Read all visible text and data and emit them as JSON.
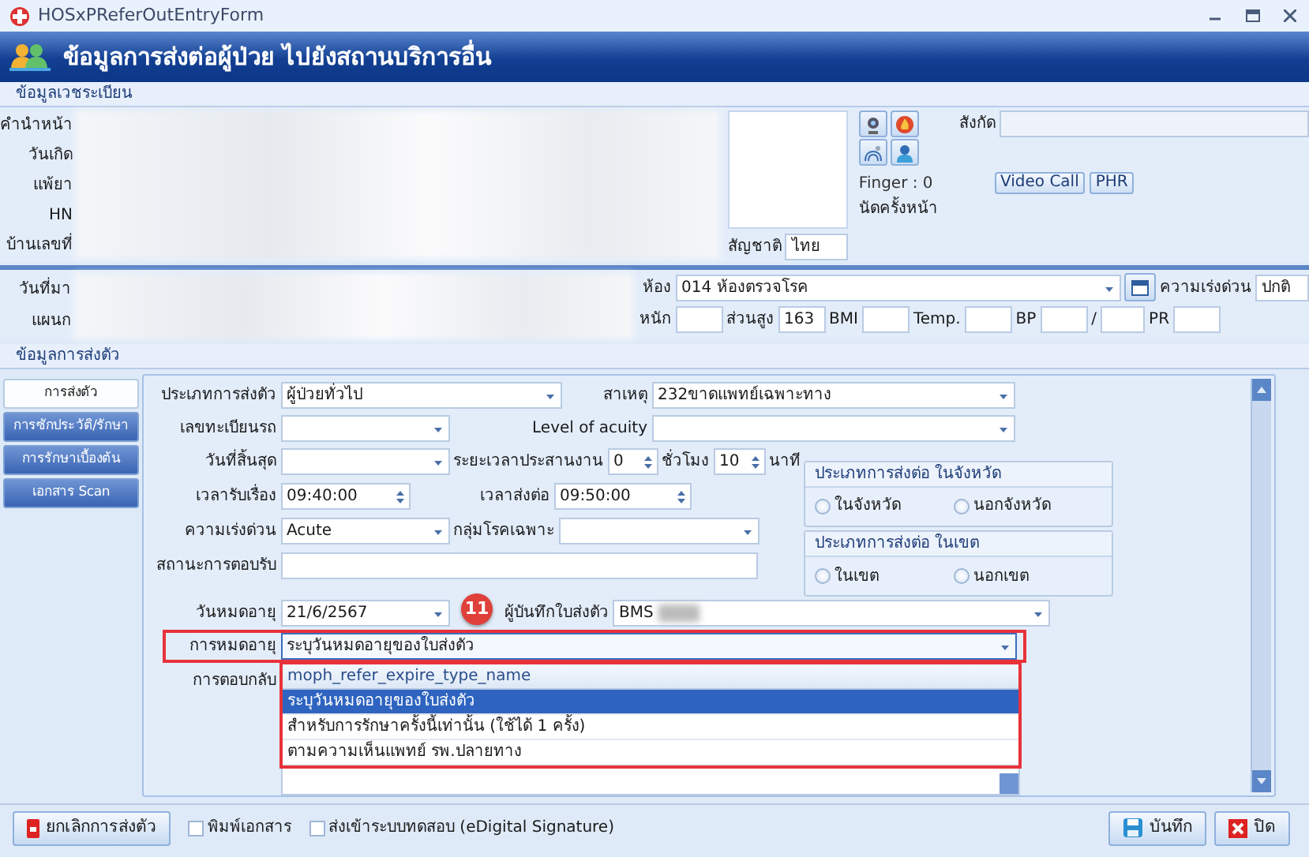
{
  "window": {
    "title": "HOSxPReferOutEntryForm"
  },
  "header": {
    "title": "ข้อมูลการส่งต่อผู้ป่วย ไปยังสถานบริการอื่น"
  },
  "registration": {
    "section_title": "ข้อมูลเวชระเบียน",
    "labels": [
      "คำนำหน้า",
      "วันเกิด",
      "แพ้ยา",
      "HN",
      "บ้านเลขที่"
    ],
    "nationality": {
      "label": "สัญชาติ",
      "value": "ไทย"
    },
    "finger": "Finger : 0",
    "next_appointment": "นัดครั้งหน้า",
    "affiliation": {
      "label": "สังกัด"
    },
    "buttons": [
      "Video Call",
      "PHR"
    ]
  },
  "visit": {
    "labels": [
      "วันที่มา",
      "แผนก"
    ],
    "room": {
      "label": "ห้อง",
      "value": "014 ห้องตรวจโรค"
    },
    "urgency": {
      "label": "ความเร่งด่วน",
      "value": "ปกติ"
    },
    "vitals": [
      {
        "label": "หนัก"
      },
      {
        "label": "ส่วนสูง",
        "value": "163"
      },
      {
        "label": "BMI"
      },
      {
        "label": "Temp."
      },
      {
        "label": "BP"
      },
      {
        "label": "/"
      },
      {
        "label": "PR"
      }
    ]
  },
  "referral": {
    "section_title": "ข้อมูลการส่งตัว",
    "tabs": [
      {
        "label": "การส่งตัว",
        "selected": true
      },
      {
        "label": "การซักประวัติ/รักษา",
        "selected": false
      },
      {
        "label": "การรักษาเบื้องต้น",
        "selected": false
      },
      {
        "label": "เอกสาร Scan",
        "selected": false
      }
    ],
    "refer_type": {
      "label": "ประเภทการส่งตัว",
      "value": "ผู้ป่วยทั่วไป"
    },
    "cause": {
      "label": "สาเหตุ",
      "value": "232ขาดแพทย์เฉพาะทาง"
    },
    "vehicle": {
      "label": "เลขทะเบียนรถ"
    },
    "acuity": {
      "label": "Level of acuity"
    },
    "end_date": {
      "label": "วันที่สิ้นสุด"
    },
    "coordination": {
      "label": "ระยะเวลาประสานงาน",
      "hours": "0",
      "hours_label": "ชั่วโมง",
      "minutes": "10",
      "minutes_label": "นาที"
    },
    "receive_time": {
      "label": "เวลารับเรื่อง",
      "value": "09:40:00"
    },
    "refer_time": {
      "label": "เวลาส่งต่อ",
      "value": "09:50:00"
    },
    "urgency": {
      "label": "ความเร่งด่วน",
      "value": "Acute"
    },
    "disease_group": {
      "label": "กลุ่มโรคเฉพาะ"
    },
    "acceptance": {
      "label": "สถานะการตอบรับ"
    },
    "expire_date": {
      "label": "วันหมดอายุ",
      "value": "21/6/2567"
    },
    "recorder": {
      "label": "ผู้บันทึกใบส่งตัว",
      "value": "BMS"
    },
    "expiry": {
      "label": "การหมดอายุ",
      "value": "ระบุวันหมดอายุของใบส่งตัว",
      "expanded": true,
      "dropdown_header": "moph_refer_expire_type_name",
      "options": [
        {
          "label": "ระบุวันหมดอายุของใบส่งตัว",
          "selected": true
        },
        {
          "label": "สำหรับการรักษาครั้งนี้เท่านั้น (ใช้ได้ 1 ครั้ง)",
          "selected": false
        },
        {
          "label": "ตามความเห็นแพทย์ รพ.ปลายทาง",
          "selected": false
        }
      ]
    },
    "reply": {
      "label": "การตอบกลับ"
    },
    "radio_groups": [
      {
        "title": "ประเภทการส่งต่อ ในจังหวัด",
        "options": [
          {
            "label": "ในจังหวัด",
            "checked": false
          },
          {
            "label": "นอกจังหวัด",
            "checked": false
          }
        ]
      },
      {
        "title": "ประเภทการส่งต่อ ในเขต",
        "options": [
          {
            "label": "ในเขต",
            "checked": false
          },
          {
            "label": "นอกเขต",
            "checked": false
          }
        ]
      }
    ]
  },
  "callout": {
    "number": "11"
  },
  "footer": {
    "cancel": "ยกเลิกการส่งตัว",
    "checkboxes": [
      {
        "label": "พิมพ์เอกสาร",
        "checked": false
      },
      {
        "label": "ส่งเข้าระบบทดสอบ (eDigital Signature)",
        "checked": false
      }
    ],
    "save": "บันทึก",
    "close": "ปิด"
  }
}
